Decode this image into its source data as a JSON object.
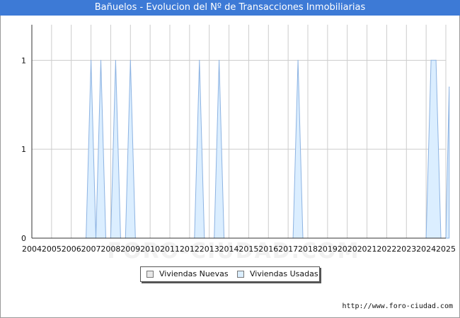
{
  "title": "Bañuelos - Evolucion del Nº de Transacciones Inmobiliarias",
  "watermark": "FORO-CIUDAD.COM",
  "url": "http://www.foro-ciudad.com",
  "colors": {
    "title_bg": "#3d7ad6",
    "nuevas_fill": "#e8e8e8",
    "usadas_fill": "#dbeeff",
    "usadas_line": "#8db3e2"
  },
  "chart_data": {
    "type": "area",
    "title": "Bañuelos - Evolucion del Nº de Transacciones Inmobiliarias",
    "xlabel": "",
    "ylabel": "",
    "x_ticks": [
      "2004",
      "2005",
      "2006",
      "2007",
      "2008",
      "2009",
      "2010",
      "2011",
      "2012",
      "2013",
      "2014",
      "2015",
      "2016",
      "2017",
      "2018",
      "2019",
      "2020",
      "2021",
      "2022",
      "2023",
      "2024",
      "2025"
    ],
    "y_ticks": [
      "0",
      "1",
      "1"
    ],
    "ylim": [
      0,
      1.2
    ],
    "xlim": [
      2004,
      2025
    ],
    "grid": true,
    "legend": "bottom-center",
    "series": [
      {
        "name": "Viviendas Nuevas",
        "points": []
      },
      {
        "name": "Viviendas Usadas",
        "points": [
          [
            2006.75,
            0
          ],
          [
            2007.0,
            1
          ],
          [
            2007.25,
            0
          ],
          [
            2007.25,
            0
          ],
          [
            2007.5,
            1
          ],
          [
            2007.75,
            0
          ],
          [
            2008.0,
            0
          ],
          [
            2008.25,
            1
          ],
          [
            2008.5,
            0
          ],
          [
            2008.75,
            0
          ],
          [
            2009.0,
            1
          ],
          [
            2009.25,
            0
          ],
          [
            2012.25,
            0
          ],
          [
            2012.5,
            1
          ],
          [
            2012.75,
            0
          ],
          [
            2013.25,
            0
          ],
          [
            2013.5,
            1
          ],
          [
            2013.75,
            0
          ],
          [
            2017.25,
            0
          ],
          [
            2017.5,
            1
          ],
          [
            2017.75,
            0
          ],
          [
            2024.0,
            0
          ],
          [
            2024.25,
            1
          ],
          [
            2024.5,
            1
          ],
          [
            2024.75,
            0
          ],
          [
            2025.0,
            0
          ],
          [
            2025.17,
            0.85
          ]
        ]
      }
    ]
  }
}
